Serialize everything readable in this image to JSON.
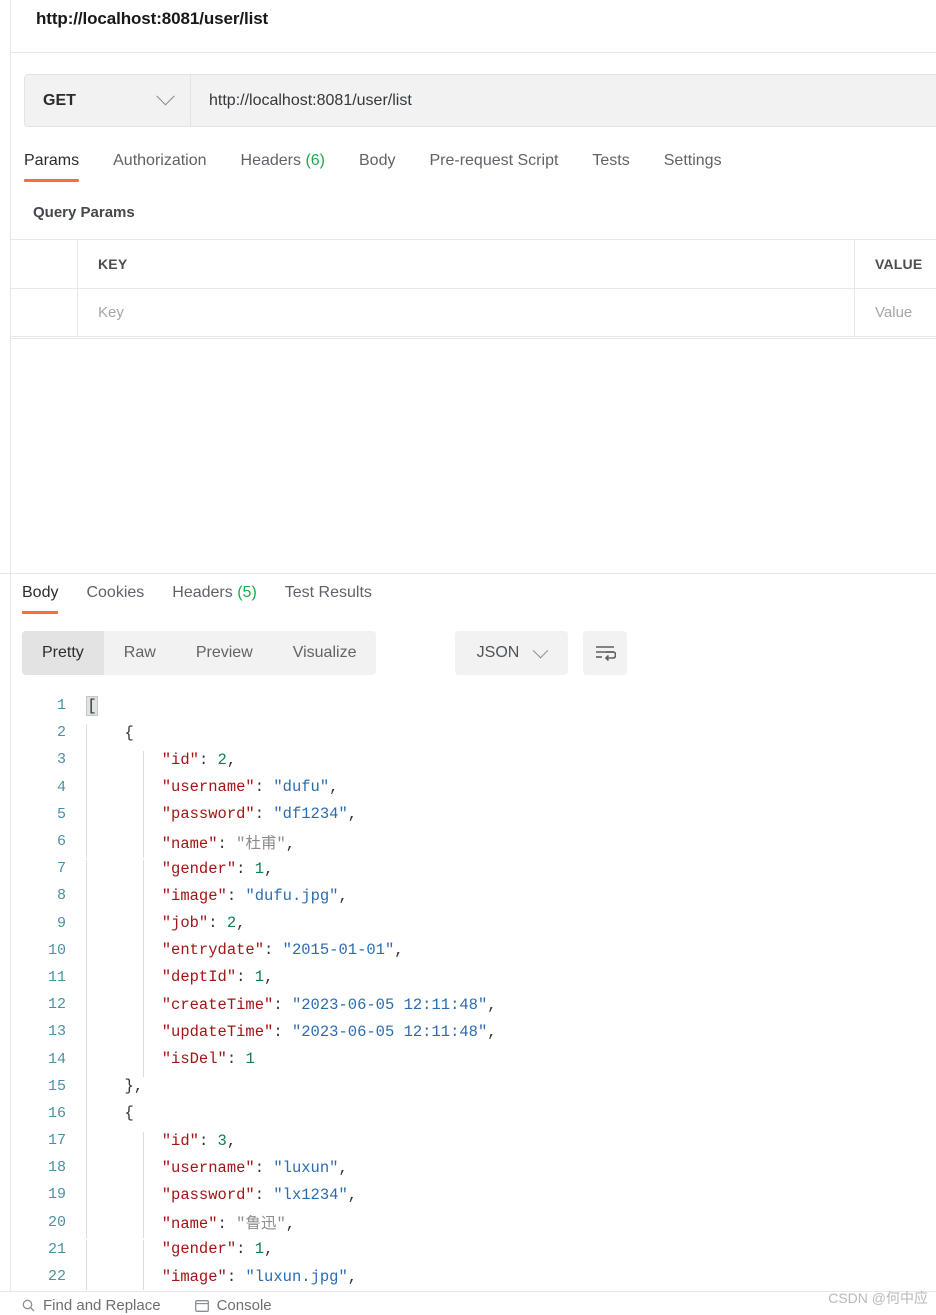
{
  "request": {
    "title": "http://localhost:8081/user/list",
    "method": "GET",
    "url": "http://localhost:8081/user/list",
    "tabs": [
      {
        "label": "Params",
        "count": "",
        "active": true
      },
      {
        "label": "Authorization",
        "count": "",
        "active": false
      },
      {
        "label": "Headers",
        "count": "(6)",
        "active": false
      },
      {
        "label": "Body",
        "count": "",
        "active": false
      },
      {
        "label": "Pre-request Script",
        "count": "",
        "active": false
      },
      {
        "label": "Tests",
        "count": "",
        "active": false
      },
      {
        "label": "Settings",
        "count": "",
        "active": false
      }
    ],
    "query_params_label": "Query Params",
    "table": {
      "headers": [
        "KEY",
        "VALUE"
      ],
      "placeholder_row": {
        "key": "Key",
        "value": "Value"
      }
    }
  },
  "response": {
    "tabs": [
      {
        "label": "Body",
        "count": "",
        "active": true
      },
      {
        "label": "Cookies",
        "count": "",
        "active": false
      },
      {
        "label": "Headers",
        "count": "(5)",
        "active": false
      },
      {
        "label": "Test Results",
        "count": "",
        "active": false
      }
    ],
    "view_modes": [
      {
        "label": "Pretty",
        "active": true
      },
      {
        "label": "Raw",
        "active": false
      },
      {
        "label": "Preview",
        "active": false
      },
      {
        "label": "Visualize",
        "active": false
      }
    ],
    "format": "JSON",
    "wrap_icon": "word-wrap-icon"
  },
  "body_json": [
    {
      "num": "1",
      "indent": 0,
      "guides": 0,
      "tokens": [
        {
          "t": "[",
          "c": "p brk-hl"
        }
      ]
    },
    {
      "num": "2",
      "indent": 1,
      "guides": 1,
      "tokens": [
        {
          "t": "{",
          "c": "p"
        }
      ]
    },
    {
      "num": "3",
      "indent": 2,
      "guides": 2,
      "tokens": [
        {
          "t": "\"id\"",
          "c": "k"
        },
        {
          "t": ": ",
          "c": "p"
        },
        {
          "t": "2",
          "c": "n"
        },
        {
          "t": ",",
          "c": "p"
        }
      ]
    },
    {
      "num": "4",
      "indent": 2,
      "guides": 2,
      "tokens": [
        {
          "t": "\"username\"",
          "c": "k"
        },
        {
          "t": ": ",
          "c": "p"
        },
        {
          "t": "\"dufu\"",
          "c": "s"
        },
        {
          "t": ",",
          "c": "p"
        }
      ]
    },
    {
      "num": "5",
      "indent": 2,
      "guides": 2,
      "tokens": [
        {
          "t": "\"password\"",
          "c": "k"
        },
        {
          "t": ": ",
          "c": "p"
        },
        {
          "t": "\"df1234\"",
          "c": "s"
        },
        {
          "t": ",",
          "c": "p"
        }
      ]
    },
    {
      "num": "6",
      "indent": 2,
      "guides": 2,
      "tokens": [
        {
          "t": "\"name\"",
          "c": "k"
        },
        {
          "t": ": ",
          "c": "p"
        },
        {
          "t": "\"杜甫\"",
          "c": "cn"
        },
        {
          "t": ",",
          "c": "p"
        }
      ]
    },
    {
      "num": "7",
      "indent": 2,
      "guides": 2,
      "tokens": [
        {
          "t": "\"gender\"",
          "c": "k"
        },
        {
          "t": ": ",
          "c": "p"
        },
        {
          "t": "1",
          "c": "n"
        },
        {
          "t": ",",
          "c": "p"
        }
      ]
    },
    {
      "num": "8",
      "indent": 2,
      "guides": 2,
      "tokens": [
        {
          "t": "\"image\"",
          "c": "k"
        },
        {
          "t": ": ",
          "c": "p"
        },
        {
          "t": "\"dufu.jpg\"",
          "c": "s"
        },
        {
          "t": ",",
          "c": "p"
        }
      ]
    },
    {
      "num": "9",
      "indent": 2,
      "guides": 2,
      "tokens": [
        {
          "t": "\"job\"",
          "c": "k"
        },
        {
          "t": ": ",
          "c": "p"
        },
        {
          "t": "2",
          "c": "n"
        },
        {
          "t": ",",
          "c": "p"
        }
      ]
    },
    {
      "num": "10",
      "indent": 2,
      "guides": 2,
      "tokens": [
        {
          "t": "\"entrydate\"",
          "c": "k"
        },
        {
          "t": ": ",
          "c": "p"
        },
        {
          "t": "\"2015-01-01\"",
          "c": "s"
        },
        {
          "t": ",",
          "c": "p"
        }
      ]
    },
    {
      "num": "11",
      "indent": 2,
      "guides": 2,
      "tokens": [
        {
          "t": "\"deptId\"",
          "c": "k"
        },
        {
          "t": ": ",
          "c": "p"
        },
        {
          "t": "1",
          "c": "n"
        },
        {
          "t": ",",
          "c": "p"
        }
      ]
    },
    {
      "num": "12",
      "indent": 2,
      "guides": 2,
      "tokens": [
        {
          "t": "\"createTime\"",
          "c": "k"
        },
        {
          "t": ": ",
          "c": "p"
        },
        {
          "t": "\"2023-06-05 12:11:48\"",
          "c": "s"
        },
        {
          "t": ",",
          "c": "p"
        }
      ]
    },
    {
      "num": "13",
      "indent": 2,
      "guides": 2,
      "tokens": [
        {
          "t": "\"updateTime\"",
          "c": "k"
        },
        {
          "t": ": ",
          "c": "p"
        },
        {
          "t": "\"2023-06-05 12:11:48\"",
          "c": "s"
        },
        {
          "t": ",",
          "c": "p"
        }
      ]
    },
    {
      "num": "14",
      "indent": 2,
      "guides": 2,
      "tokens": [
        {
          "t": "\"isDel\"",
          "c": "k"
        },
        {
          "t": ": ",
          "c": "p"
        },
        {
          "t": "1",
          "c": "n"
        }
      ]
    },
    {
      "num": "15",
      "indent": 1,
      "guides": 1,
      "tokens": [
        {
          "t": "},",
          "c": "p"
        }
      ]
    },
    {
      "num": "16",
      "indent": 1,
      "guides": 1,
      "tokens": [
        {
          "t": "{",
          "c": "p"
        }
      ]
    },
    {
      "num": "17",
      "indent": 2,
      "guides": 2,
      "tokens": [
        {
          "t": "\"id\"",
          "c": "k"
        },
        {
          "t": ": ",
          "c": "p"
        },
        {
          "t": "3",
          "c": "n"
        },
        {
          "t": ",",
          "c": "p"
        }
      ]
    },
    {
      "num": "18",
      "indent": 2,
      "guides": 2,
      "tokens": [
        {
          "t": "\"username\"",
          "c": "k"
        },
        {
          "t": ": ",
          "c": "p"
        },
        {
          "t": "\"luxun\"",
          "c": "s"
        },
        {
          "t": ",",
          "c": "p"
        }
      ]
    },
    {
      "num": "19",
      "indent": 2,
      "guides": 2,
      "tokens": [
        {
          "t": "\"password\"",
          "c": "k"
        },
        {
          "t": ": ",
          "c": "p"
        },
        {
          "t": "\"lx1234\"",
          "c": "s"
        },
        {
          "t": ",",
          "c": "p"
        }
      ]
    },
    {
      "num": "20",
      "indent": 2,
      "guides": 2,
      "tokens": [
        {
          "t": "\"name\"",
          "c": "k"
        },
        {
          "t": ": ",
          "c": "p"
        },
        {
          "t": "\"鲁迅\"",
          "c": "cn"
        },
        {
          "t": ",",
          "c": "p"
        }
      ]
    },
    {
      "num": "21",
      "indent": 2,
      "guides": 2,
      "tokens": [
        {
          "t": "\"gender\"",
          "c": "k"
        },
        {
          "t": ": ",
          "c": "p"
        },
        {
          "t": "1",
          "c": "n"
        },
        {
          "t": ",",
          "c": "p"
        }
      ]
    },
    {
      "num": "22",
      "indent": 2,
      "guides": 2,
      "tokens": [
        {
          "t": "\"image\"",
          "c": "k"
        },
        {
          "t": ": ",
          "c": "p"
        },
        {
          "t": "\"luxun.jpg\"",
          "c": "s"
        },
        {
          "t": ",",
          "c": "p"
        }
      ]
    }
  ],
  "bottom_bar": {
    "find_and_replace": "Find and Replace",
    "console": "Console"
  },
  "watermark": "CSDN @何中应",
  "colors": {
    "accent": "#ff6c37",
    "count_green": "#1aab4b",
    "json_key": "#a31515",
    "json_string": "#2b6cb0",
    "json_number": "#0d8050"
  }
}
